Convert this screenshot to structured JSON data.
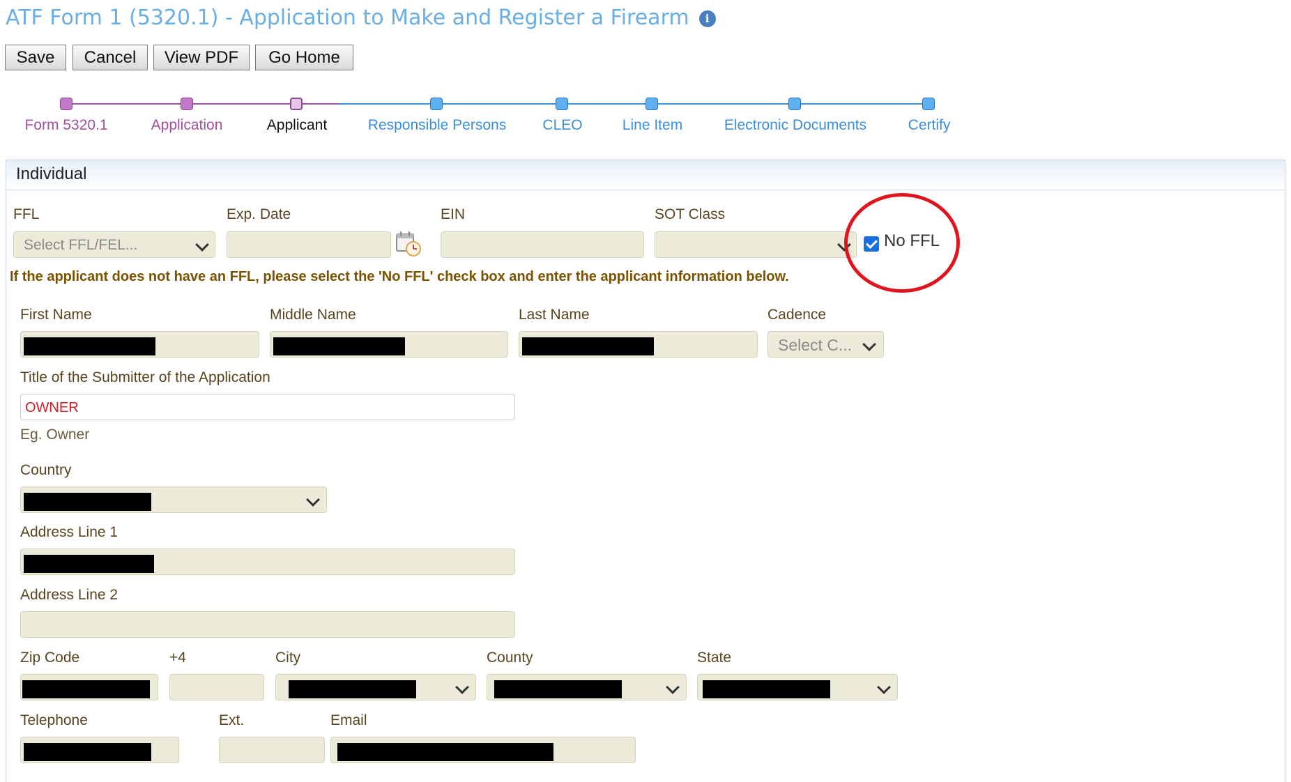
{
  "header": {
    "title": "ATF Form 1 (5320.1) - Application to Make and Register a Firearm",
    "info_icon": "info-icon"
  },
  "toolbar": {
    "save_label": "Save",
    "cancel_label": "Cancel",
    "view_pdf_label": "View PDF",
    "go_home_label": "Go Home"
  },
  "steps": [
    {
      "label": "Form 5320.1",
      "state": "complete"
    },
    {
      "label": "Application",
      "state": "complete"
    },
    {
      "label": "Applicant",
      "state": "current"
    },
    {
      "label": "Responsible Persons",
      "state": "pending"
    },
    {
      "label": "CLEO",
      "state": "pending"
    },
    {
      "label": "Line Item",
      "state": "pending"
    },
    {
      "label": "Electronic Documents",
      "state": "pending"
    },
    {
      "label": "Certify",
      "state": "pending"
    }
  ],
  "panel": {
    "title": "Individual"
  },
  "ffl_section": {
    "ffl_label": "FFL",
    "ffl_placeholder": "Select FFL/FEL...",
    "exp_date_label": "Exp. Date",
    "ein_label": "EIN",
    "sot_class_label": "SOT Class",
    "no_ffl_label": "No FFL",
    "no_ffl_checked": true,
    "notice": "If the applicant does not have an FFL, please select the 'No FFL' check box and enter the applicant information below."
  },
  "applicant": {
    "first_name_label": "First Name",
    "middle_name_label": "Middle Name",
    "last_name_label": "Last Name",
    "cadence_label": "Cadence",
    "cadence_placeholder": "Select C...",
    "title_label": "Title of the Submitter of the Application",
    "title_value": "OWNER",
    "title_hint": "Eg. Owner",
    "country_label": "Country",
    "address1_label": "Address Line 1",
    "address2_label": "Address Line 2",
    "zip_label": "Zip Code",
    "plus4_label": "+4",
    "city_label": "City",
    "county_label": "County",
    "state_label": "State",
    "telephone_label": "Telephone",
    "ext_label": "Ext.",
    "email_label": "Email"
  },
  "colors": {
    "title": "#6aaee6",
    "step_complete": "#a0509f",
    "step_pending": "#3a8fd8",
    "field_bg": "#ecebd9",
    "notice": "#7a5200",
    "highlight_circle": "#e0141e",
    "owner_value": "#d0202a"
  }
}
